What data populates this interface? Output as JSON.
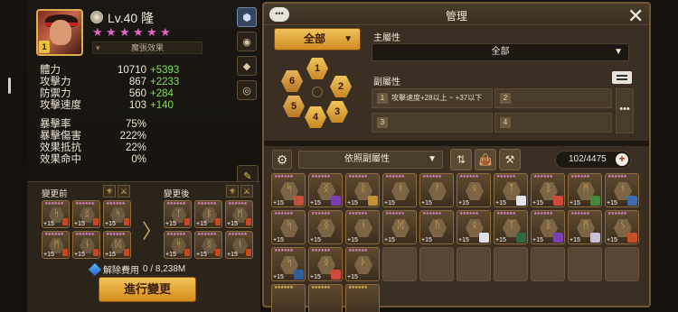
{
  "hero": {
    "level": "Lv.40",
    "name": "隆",
    "badge": "1",
    "stars": [
      "★",
      "★",
      "★",
      "★",
      "★",
      "★"
    ],
    "skill_tag": "魔張效果"
  },
  "stats": [
    {
      "label": "體力",
      "value": "10710",
      "bonus": "+5393"
    },
    {
      "label": "攻擊力",
      "value": "867",
      "bonus": "+2233"
    },
    {
      "label": "防禦力",
      "value": "560",
      "bonus": "+284"
    },
    {
      "label": "攻擊速度",
      "value": "103",
      "bonus": "+140"
    }
  ],
  "stats2": [
    {
      "label": "暴擊率",
      "value": "75%"
    },
    {
      "label": "暴擊傷害",
      "value": "222%"
    },
    {
      "label": "效果抵抗",
      "value": "22%"
    },
    {
      "label": "效果命中",
      "value": "0%"
    }
  ],
  "change": {
    "before_label": "變更前",
    "after_label": "變更後",
    "plus": "+15",
    "fee_label": "解除費用",
    "fee_value": "0 / 8,238M",
    "exec_label": "進行變更"
  },
  "panel": {
    "title": "管理",
    "chat": "•••",
    "close": "✕",
    "all_label": "全部",
    "slots": [
      "1",
      "2",
      "3",
      "4",
      "5",
      "6"
    ],
    "main_attr_label": "主屬性",
    "main_attr_value": "全部",
    "sub_attr_label": "副屬性",
    "sub_cells": [
      {
        "n": "1",
        "text": "攻擊速度+28以上 ~ +37以下"
      },
      {
        "n": "2",
        "text": ""
      },
      {
        "n": "3",
        "text": ""
      },
      {
        "n": "4",
        "text": ""
      }
    ],
    "sub_more": "•••",
    "sort_label": "依照副屬性",
    "count": "102/4475",
    "count_plus": "+"
  },
  "inventory": [
    {
      "rune": "ᛋ",
      "plus": "+15",
      "mon": "#c2503a"
    },
    {
      "rune": "ᛝ",
      "plus": "+15",
      "mon": "#7a3fb0"
    },
    {
      "rune": "ᚱ",
      "plus": "+15",
      "mon": "#c7912e"
    },
    {
      "rune": "ᚼ",
      "plus": "+15",
      "mon": ""
    },
    {
      "rune": "ᚨ",
      "plus": "+15",
      "mon": ""
    },
    {
      "rune": "ᛟ",
      "plus": "+15",
      "mon": ""
    },
    {
      "rune": "ᛉ",
      "plus": "+15",
      "mon": "#e4e4ee"
    },
    {
      "rune": "ᛒ",
      "plus": "+15",
      "mon": "#d24a3a"
    },
    {
      "rune": "ᛗ",
      "plus": "+15",
      "mon": "#3f8c3a"
    },
    {
      "rune": "ᚾ",
      "plus": "+15",
      "mon": "#3f6ab0"
    },
    {
      "rune": "ᛋ",
      "plus": "+15",
      "mon": ""
    },
    {
      "rune": "ᛝ",
      "plus": "+15",
      "mon": ""
    },
    {
      "rune": "ᚾ",
      "plus": "+15",
      "mon": ""
    },
    {
      "rune": "ᛞ",
      "plus": "+15",
      "mon": ""
    },
    {
      "rune": "ᚢ",
      "plus": "+15",
      "mon": ""
    },
    {
      "rune": "ᛟ",
      "plus": "+15",
      "mon": "#e0e0e8"
    },
    {
      "rune": "ᛉ",
      "plus": "+15",
      "mon": "#2e6a3c"
    },
    {
      "rune": "ᛒ",
      "plus": "+15",
      "mon": "#7a3fb0"
    },
    {
      "rune": "ᛗ",
      "plus": "+15",
      "mon": "#c9c0d8"
    },
    {
      "rune": "ᛊ",
      "plus": "+15",
      "mon": "#c94f2a"
    },
    {
      "rune": "ᛋ",
      "plus": "+15",
      "mon": "#2d5ea0"
    },
    {
      "rune": "ᛝ",
      "plus": "+15",
      "mon": "#d24a3a"
    },
    {
      "rune": "ᚦ",
      "plus": "+15",
      "mon": ""
    },
    {
      "rune": "",
      "plus": "",
      "mon": "",
      "empty": true
    },
    {
      "rune": "",
      "plus": "",
      "mon": "",
      "empty": true
    },
    {
      "rune": "",
      "plus": "",
      "mon": "",
      "empty": true
    },
    {
      "rune": "",
      "plus": "",
      "mon": "",
      "empty": true
    },
    {
      "rune": "",
      "plus": "",
      "mon": "",
      "empty": true
    },
    {
      "rune": "",
      "plus": "",
      "mon": "",
      "empty": true
    },
    {
      "rune": "",
      "plus": "",
      "mon": "",
      "empty": true
    },
    {
      "rune": "",
      "plus": "",
      "mon": "",
      "gold": true
    },
    {
      "rune": "",
      "plus": "",
      "mon": "",
      "gold": true
    },
    {
      "rune": "",
      "plus": "",
      "mon": "",
      "gold": true
    }
  ],
  "before_runes": [
    "ᛋ",
    "ᛝ",
    "ᛋ",
    "ᛗ",
    "ᚾ",
    "ᛞ"
  ],
  "after_runes": [
    "ᛉ",
    "ᛒ",
    "ᛗ",
    "ᛋ",
    "ᛝ",
    "ᚾ"
  ]
}
